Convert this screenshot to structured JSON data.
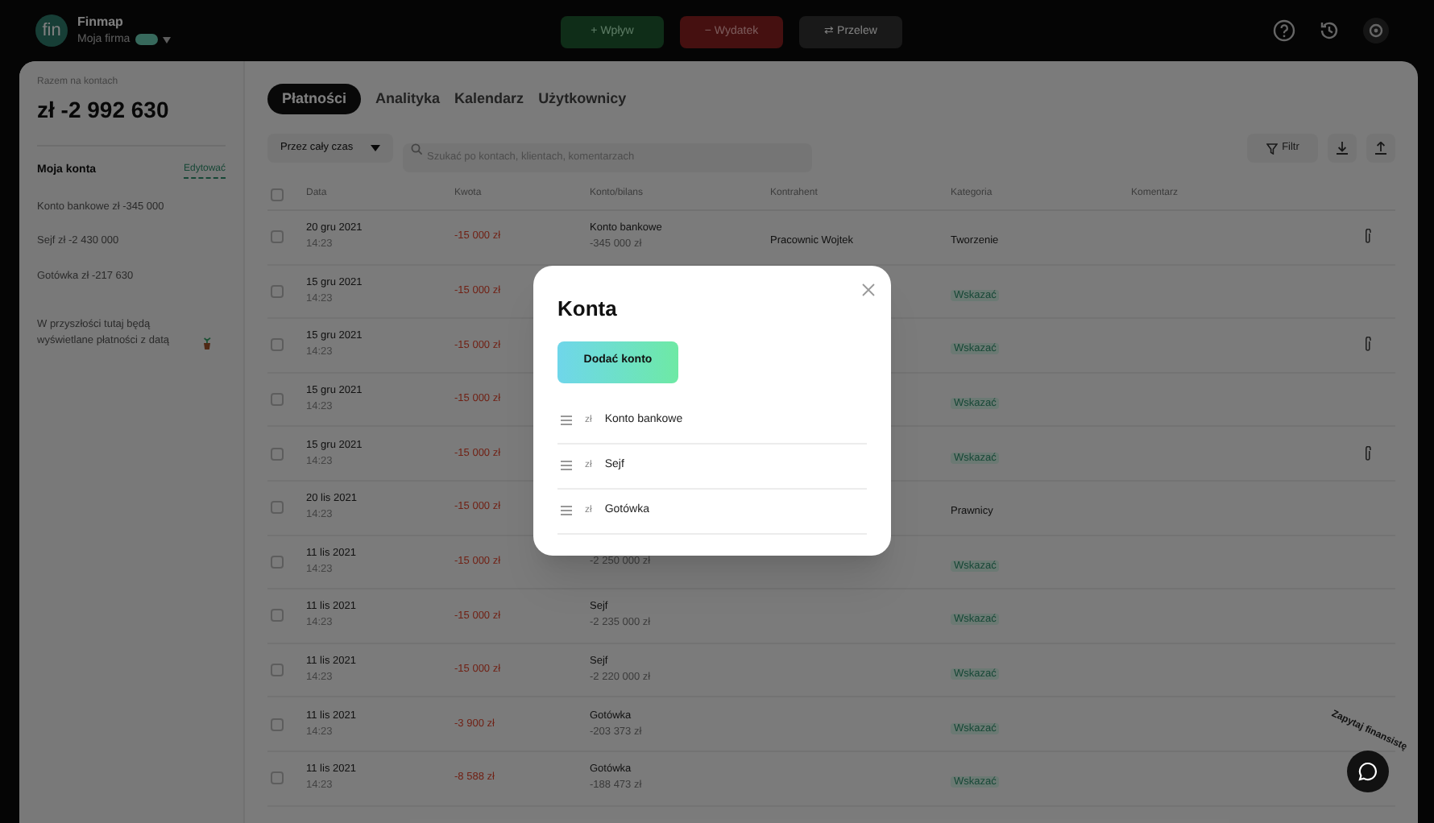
{
  "app": {
    "logo": "fin",
    "name": "Finmap",
    "company": "Moja firma"
  },
  "actions": [
    {
      "kind": "income",
      "icon": "+",
      "label": "Wpływ"
    },
    {
      "kind": "expense",
      "icon": "−",
      "label": "Wydatek"
    },
    {
      "kind": "transfer",
      "icon": "⇄",
      "label": "Przelew"
    }
  ],
  "sidebar": {
    "total_label": "Razem na kontach",
    "total": "zł -2 992 630",
    "accounts_title": "Moja konta",
    "edit_link": "Edytować",
    "accounts": [
      {
        "name": "Konto bankowe",
        "amount": "zł -345 000"
      },
      {
        "name": "Sejf",
        "amount": "zł -2 430 000"
      },
      {
        "name": "Gotówka",
        "amount": "zł -217 630"
      }
    ],
    "note": "W przyszłości tutaj będą wyświetlane płatności z datą"
  },
  "tabs": [
    {
      "label": "Płatności",
      "selected": true
    },
    {
      "label": "Analityka",
      "selected": false
    },
    {
      "label": "Kalendarz",
      "selected": false
    },
    {
      "label": "Użytkownicy",
      "selected": false
    }
  ],
  "period": "Przez cały czas",
  "search": {
    "placeholder": "Szukać po kontach, klientach, komentarzach"
  },
  "filter": "Filtr",
  "table": {
    "all_checked": false,
    "columns": [
      "Data",
      "Kwota",
      "Konto/bilans",
      "Kontrahent",
      "Kategoria",
      "Komentarz"
    ],
    "rows": [
      {
        "checked": false,
        "date": "20 gru 2021",
        "time": "14:23",
        "amount": "-15 000 zł",
        "account": "Konto bankowe",
        "balance": "-345 000 zł",
        "counterparty": "Pracownic Wojtek",
        "category": "Tworzenie",
        "kind": "text",
        "attachment": true
      },
      {
        "checked": false,
        "date": "15 gru 2021",
        "time": "14:23",
        "amount": "-15 000 zł",
        "category": "Wskazać",
        "kind": "tag",
        "attachment": false
      },
      {
        "checked": false,
        "date": "15 gru 2021",
        "time": "14:23",
        "amount": "-15 000 zł",
        "category": "Wskazać",
        "kind": "tag",
        "attachment": true
      },
      {
        "checked": false,
        "date": "15 gru 2021",
        "time": "14:23",
        "amount": "-15 000 zł",
        "category": "Wskazać",
        "kind": "tag",
        "attachment": false
      },
      {
        "checked": false,
        "date": "15 gru 2021",
        "time": "14:23",
        "amount": "-15 000 zł",
        "category": "Wskazać",
        "kind": "tag",
        "attachment": true
      },
      {
        "checked": false,
        "date": "20 lis 2021",
        "time": "14:23",
        "amount": "-15 000 zł",
        "category": "Prawnicy",
        "kind": "text",
        "attachment": false
      },
      {
        "checked": false,
        "date": "11 lis 2021",
        "time": "14:23",
        "amount": "-15 000 zł",
        "balance": "-2 250 000 zł",
        "category": "Wskazać",
        "kind": "tag",
        "attachment": false
      },
      {
        "checked": false,
        "date": "11 lis 2021",
        "time": "14:23",
        "amount": "-15 000 zł",
        "account": "Sejf",
        "balance": "-2 235 000 zł",
        "category": "Wskazać",
        "kind": "tag",
        "attachment": false
      },
      {
        "checked": false,
        "date": "11 lis 2021",
        "time": "14:23",
        "amount": "-15 000 zł",
        "account": "Sejf",
        "balance": "-2 220 000 zł",
        "category": "Wskazać",
        "kind": "tag",
        "attachment": false
      },
      {
        "checked": false,
        "date": "11 lis 2021",
        "time": "14:23",
        "amount": "-3 900 zł",
        "account": "Gotówka",
        "balance": "-203 373 zł",
        "category": "Wskazać",
        "kind": "tag",
        "attachment": false
      },
      {
        "checked": false,
        "date": "11 lis 2021",
        "time": "14:23",
        "amount": "-8 588 zł",
        "account": "Gotówka",
        "balance": "-188 473 zł",
        "category": "Wskazać",
        "kind": "tag",
        "attachment": false
      }
    ]
  },
  "chat": {
    "label": "Zapytaj finansistę"
  },
  "modal": {
    "title": "Konta",
    "button": "Dodać konto",
    "accounts": [
      {
        "currency": "zł",
        "name": "Konto bankowe"
      },
      {
        "currency": "zł",
        "name": "Sejf"
      },
      {
        "currency": "zł",
        "name": "Gotówka"
      }
    ]
  }
}
